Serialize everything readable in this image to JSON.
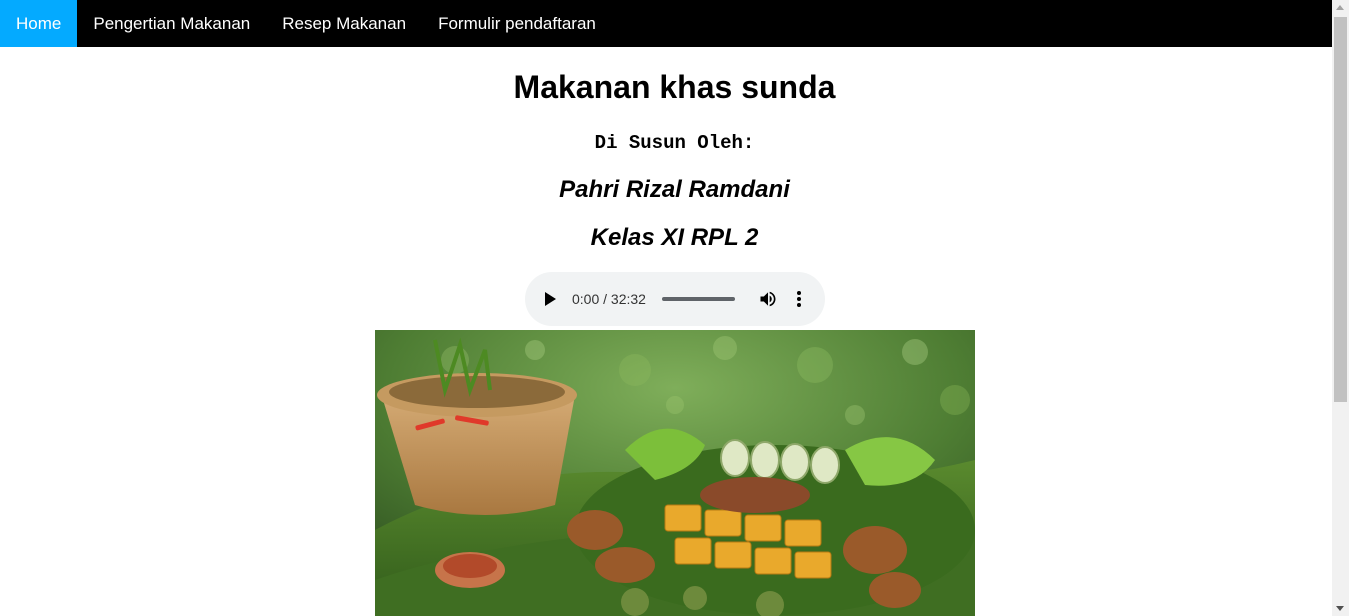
{
  "nav": {
    "items": [
      {
        "label": "Home",
        "active": true
      },
      {
        "label": "Pengertian Makanan",
        "active": false
      },
      {
        "label": "Resep Makanan",
        "active": false
      },
      {
        "label": "Formulir pendaftaran",
        "active": false
      }
    ],
    "active_color": "#04aaff",
    "background_color": "#000000"
  },
  "main": {
    "title": "Makanan khas sunda",
    "byline": "Di Susun Oleh:",
    "author": "Pahri Rizal Ramdani",
    "class": "Kelas XI RPL 2"
  },
  "audio": {
    "time": "0:00 / 32:32",
    "progress": 0,
    "play_icon": "play-icon",
    "volume_icon": "volume-icon",
    "more_icon": "more-vertical-icon"
  },
  "image": {
    "subject": "sundanese-food-platter"
  }
}
